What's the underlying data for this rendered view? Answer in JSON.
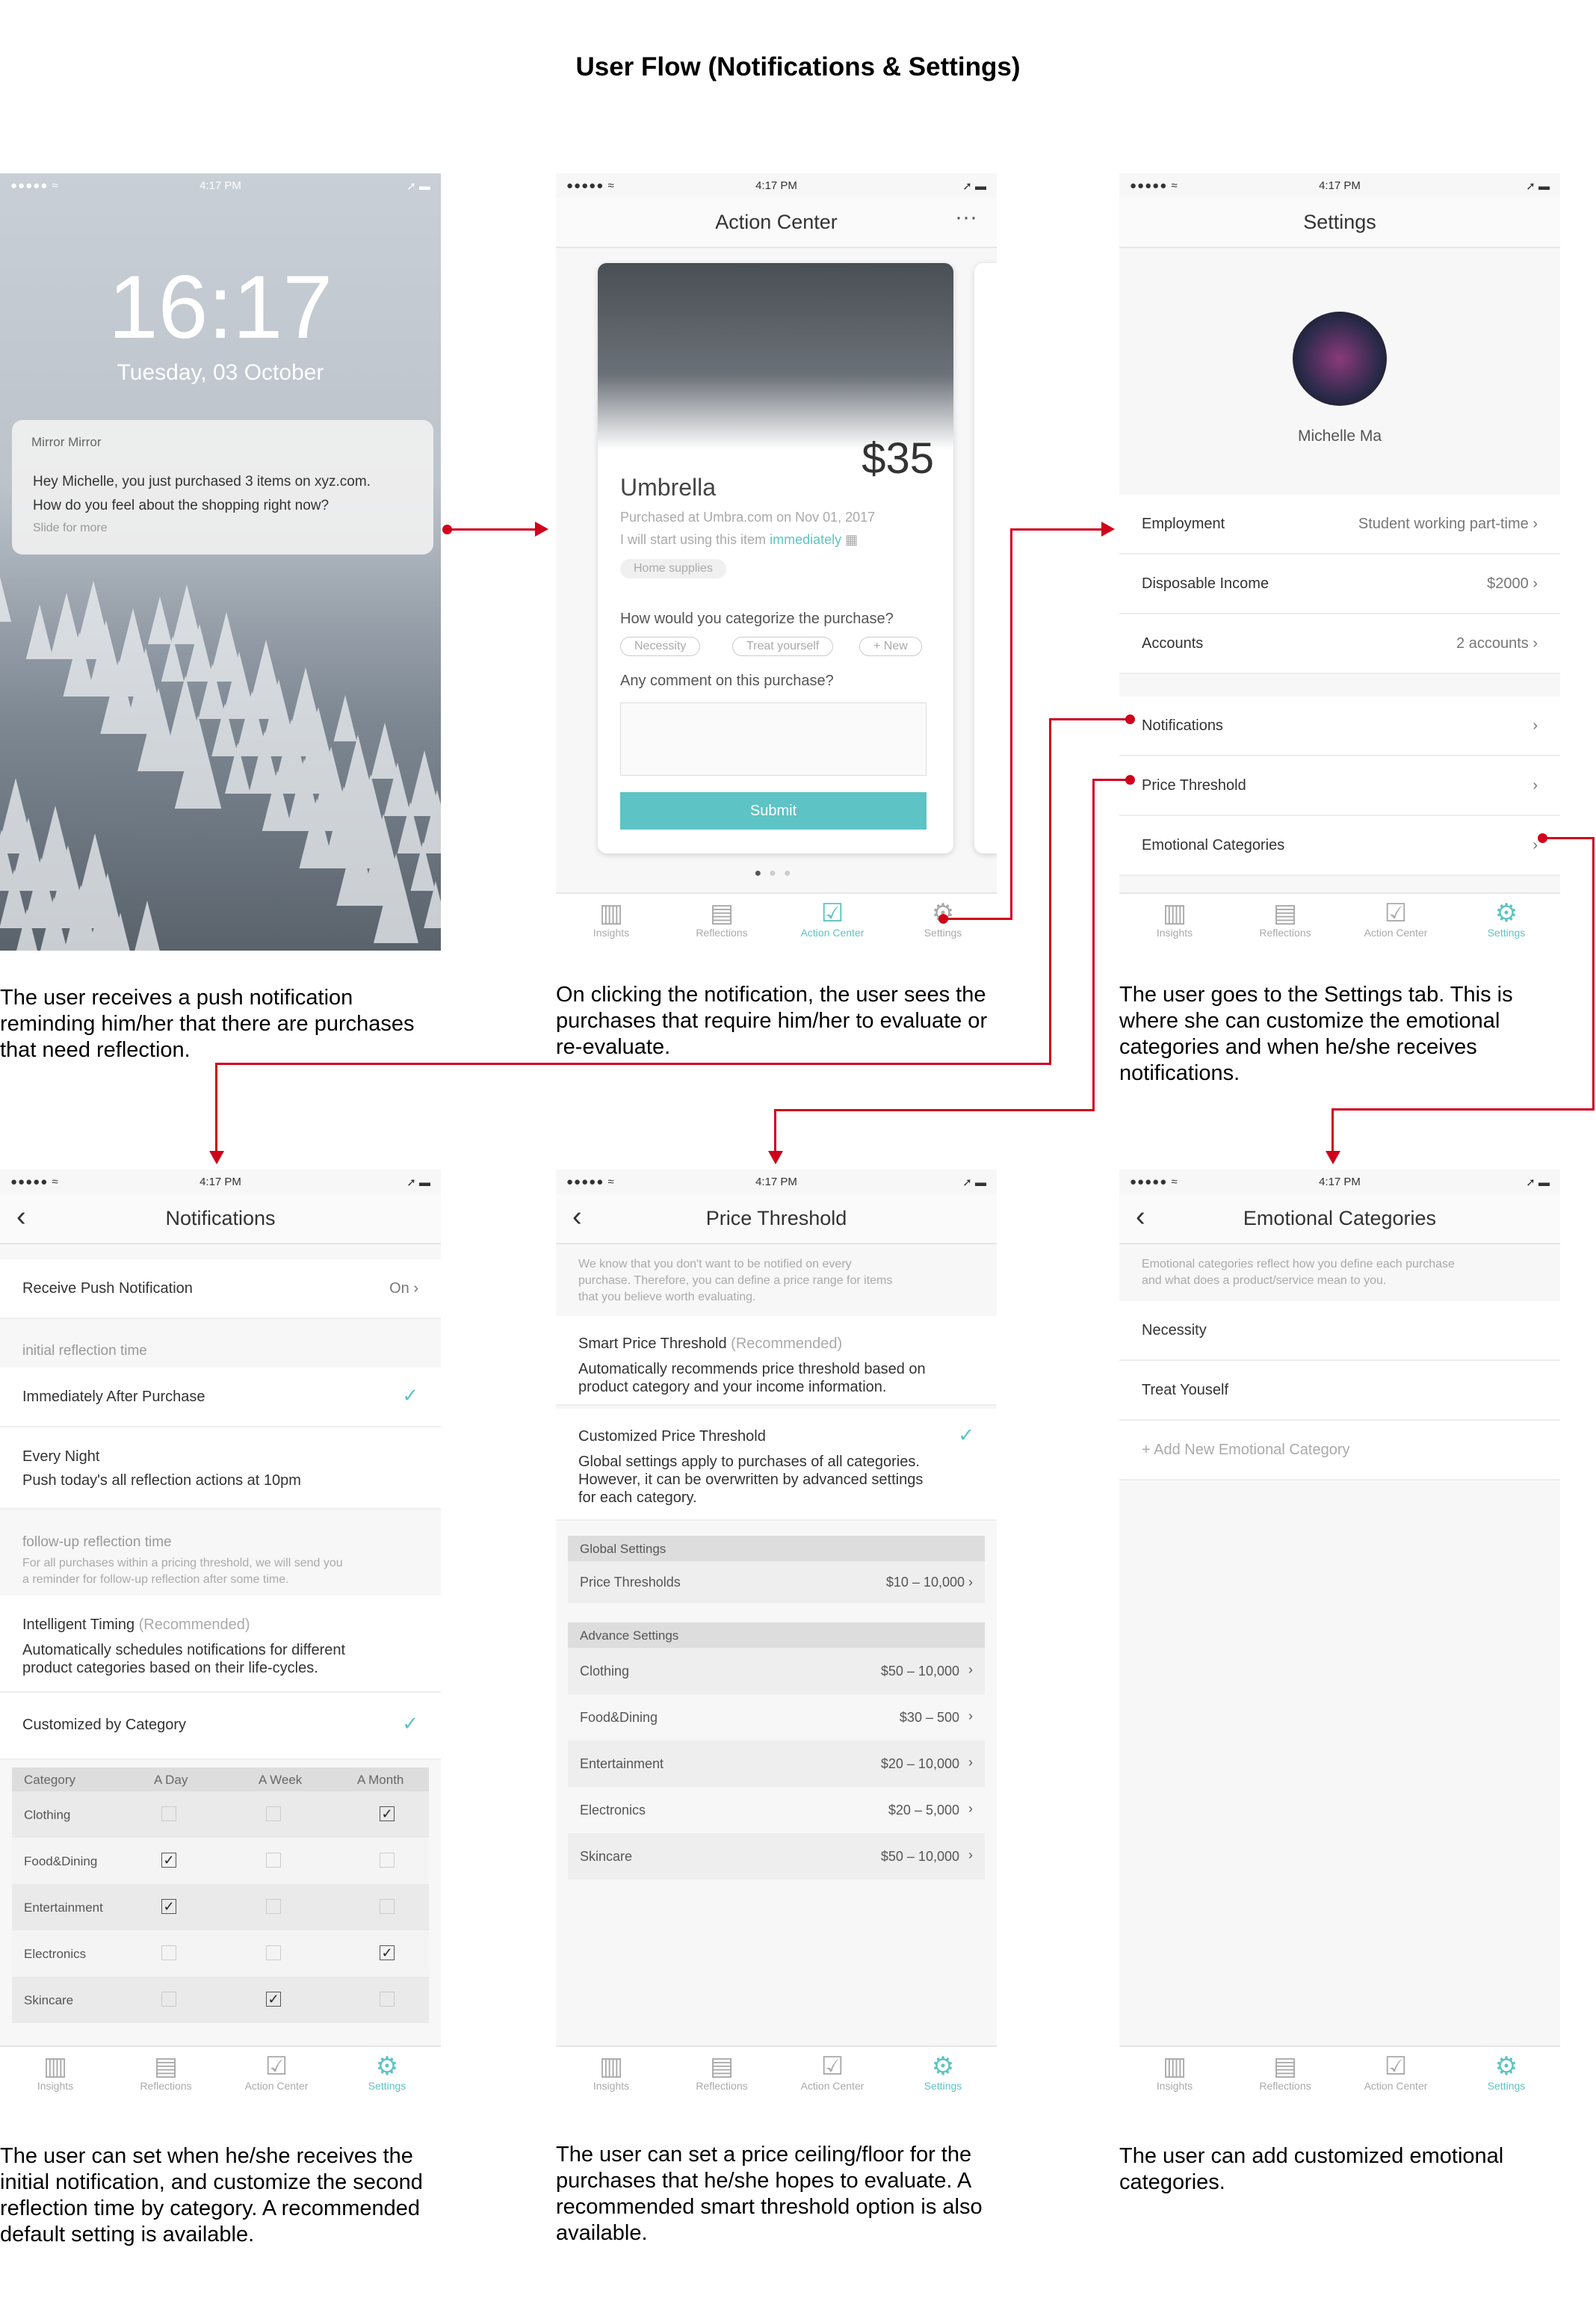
{
  "title": "User Flow (Notifications & Settings)",
  "status": {
    "time": "4:17 PM",
    "dots": "●●●●● ≈",
    "battery": "➚ ▬"
  },
  "lock": {
    "time": "16:17",
    "date": "Tuesday, 03 October",
    "app": "Mirror Mirror",
    "msg1": "Hey Michelle, you just purchased 3 items on xyz.com.",
    "msg2": "How do you feel about the shopping right now?",
    "slide": "Slide for more"
  },
  "action": {
    "title": "Action Center",
    "more": "···",
    "price": "$35",
    "item": "Umbrella",
    "purchased": "Purchased at Umbra.com on Nov 01, 2017",
    "use": "I will start using this item",
    "immediately": "immediately",
    "tag": "Home supplies",
    "q1": "How would you categorize the purchase?",
    "tags": [
      "Necessity",
      "Treat yourself",
      "+ New"
    ],
    "q2": "Any comment on this purchase?",
    "submit": "Submit"
  },
  "tabs": [
    "Insights",
    "Reflections",
    "Action Center",
    "Settings"
  ],
  "settings": {
    "title": "Settings",
    "name": "Michelle Ma",
    "rows": [
      {
        "l": "Employment",
        "r": "Student working part-time"
      },
      {
        "l": "Disposable Income",
        "r": "$2000"
      },
      {
        "l": "Accounts",
        "r": "2 accounts"
      },
      {
        "l": "Notifications",
        "r": ""
      },
      {
        "l": "Price Threshold",
        "r": ""
      },
      {
        "l": "Emotional Categories",
        "r": ""
      }
    ]
  },
  "notif": {
    "title": "Notifications",
    "push": "Receive Push Notification",
    "on": "On",
    "init": "initial reflection time",
    "imm": "Immediately After Purchase",
    "night": "Every Night",
    "nightsub": "Push today's all reflection actions at 10pm",
    "follow": "follow-up reflection time",
    "followsub1": "For all purchases within a pricing threshold, we will send you",
    "followsub2": "a reminder for follow-up reflection after some time.",
    "intel": "Intelligent Timing",
    "rec": "(Recommended)",
    "intelsub1": "Automatically schedules notifications for different",
    "intelsub2": "product categories based on their life-cycles.",
    "custom": "Customized by Category",
    "cols": [
      "Category",
      "A Day",
      "A Week",
      "A Month"
    ],
    "cats": [
      "Clothing",
      "Food&Dining",
      "Entertainment",
      "Electronics",
      "Skincare"
    ]
  },
  "price": {
    "title": "Price Threshold",
    "intro1": "We know that you don't want to be notified on every",
    "intro2": "purchase. Therefore, you can define a price range for items",
    "intro3": "that you believe worth evaluating.",
    "smart": "Smart Price Threshold",
    "rec": "(Recommended)",
    "smartsub1": "Automatically recommends price threshold based on",
    "smartsub2": "product category and your income information.",
    "custom": "Customized Price Threshold",
    "customsub1": "Global settings apply to purchases of all categories.",
    "customsub2": "However, it can be overwritten by advanced settings",
    "customsub3": "for each category.",
    "global": "Global Settings",
    "thr": "Price Thresholds",
    "thrval": "$10 – 10,000",
    "adv": "Advance Settings",
    "rows": [
      {
        "l": "Clothing",
        "r": "$50 – 10,000"
      },
      {
        "l": "Food&Dining",
        "r": "$30 – 500"
      },
      {
        "l": "Entertainment",
        "r": "$20 – 10,000"
      },
      {
        "l": "Electronics",
        "r": "$20 – 5,000"
      },
      {
        "l": "Skincare",
        "r": "$50 – 10,000"
      }
    ]
  },
  "emo": {
    "title": "Emotional Categories",
    "intro1": "Emotional categories reflect how you define each purchase",
    "intro2": "and what does a product/service mean to you.",
    "items": [
      "Necessity",
      "Treat Youself",
      "+ Add New Emotional Category"
    ]
  },
  "captions": [
    "The user receives a push notification reminding him/her that there are purchases that need reflection.",
    "On clicking the notification, the user sees the purchases that require him/her to evaluate or re-evaluate.",
    "The user goes to the Settings tab. This is where she can customize the emotional categories and when he/she receives notifications.",
    "The user can set when he/she receives the initial notification, and customize the second reflection time by category. A recommended default setting is available.",
    "The user can set a price ceiling/floor for the purchases that he/she hopes to evaluate. A recommended smart threshold option is also available.",
    "The user can add customized emotional categories."
  ],
  "colors": {
    "accent": "#5ec3c4",
    "arrow": "#d0021b"
  }
}
